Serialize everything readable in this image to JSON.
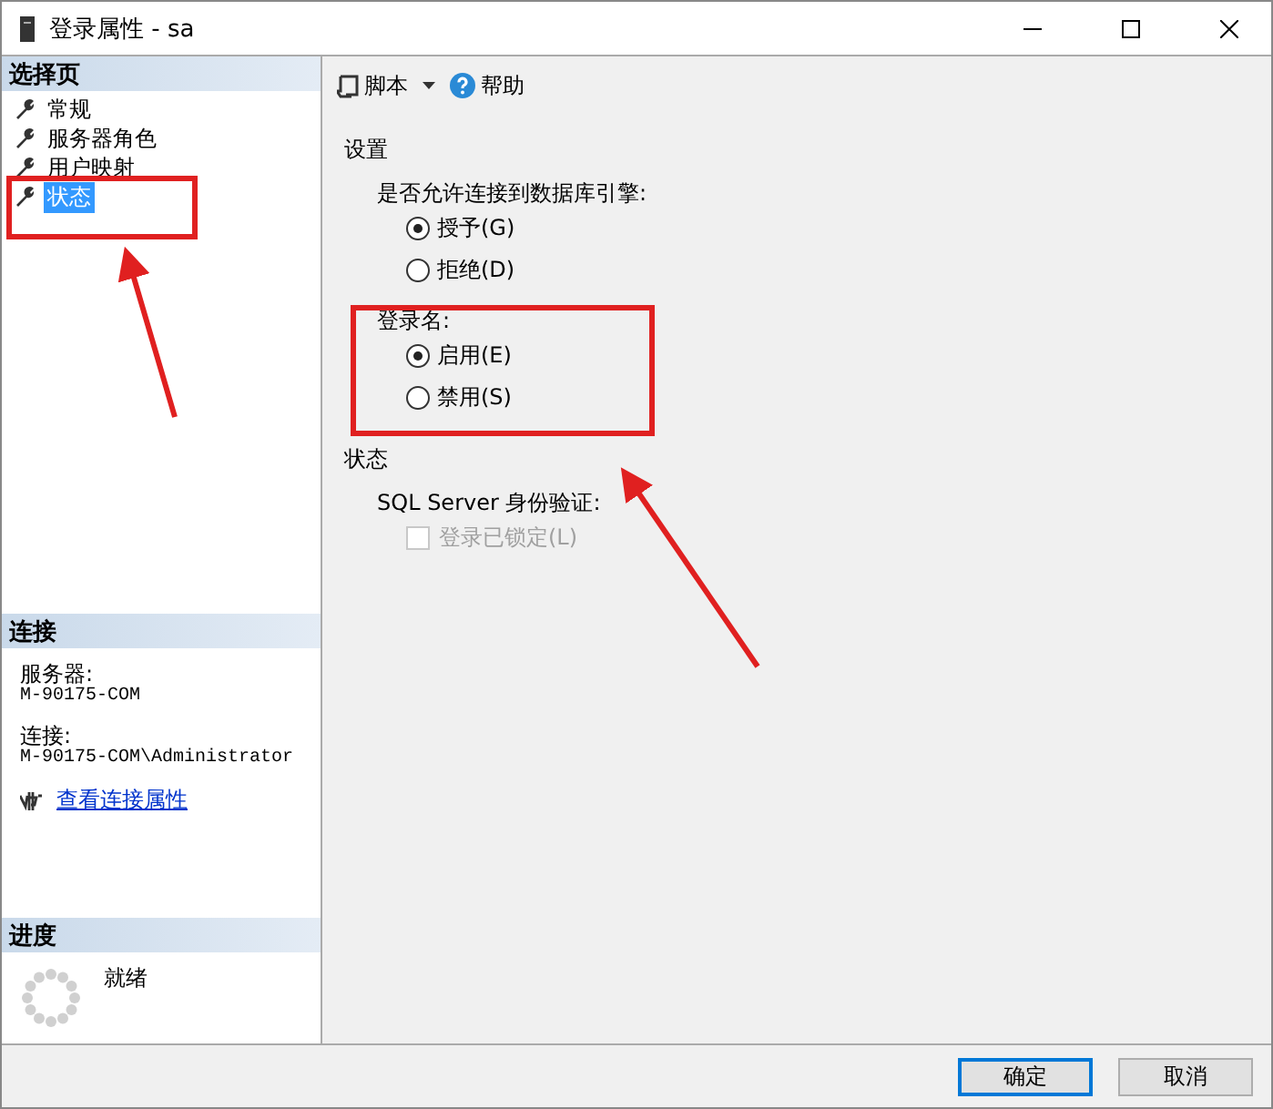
{
  "window": {
    "title": "登录属性 - sa"
  },
  "sidebar": {
    "header": "选择页",
    "pages": [
      {
        "label": "常规",
        "selected": false
      },
      {
        "label": "服务器角色",
        "selected": false
      },
      {
        "label": "用户映射",
        "selected": false
      },
      {
        "label": "状态",
        "selected": true
      }
    ]
  },
  "connection": {
    "header": "连接",
    "server_label": "服务器:",
    "server": "M-90175-COM",
    "connection_label": "连接:",
    "connection": "M-90175-COM\\Administrator",
    "link": "查看连接属性"
  },
  "progress": {
    "header": "进度",
    "status": "就绪"
  },
  "toolbar": {
    "script": "脚本",
    "help": "帮助"
  },
  "settings": {
    "heading": "设置",
    "groups": [
      {
        "label": "是否允许连接到数据库引擎:",
        "options": [
          {
            "label": "授予(G)",
            "selected": true
          },
          {
            "label": "拒绝(D)",
            "selected": false
          }
        ]
      },
      {
        "label": "登录名:",
        "options": [
          {
            "label": "启用(E)",
            "selected": true
          },
          {
            "label": "禁用(S)",
            "selected": false
          }
        ]
      }
    ]
  },
  "status": {
    "heading": "状态",
    "auth_label": "SQL Server 身份验证:",
    "locked": {
      "label": "登录已锁定(L)",
      "checked": false,
      "disabled": true
    }
  },
  "buttons": [
    {
      "label": "确定",
      "default": true
    },
    {
      "label": "取消",
      "default": false
    }
  ]
}
